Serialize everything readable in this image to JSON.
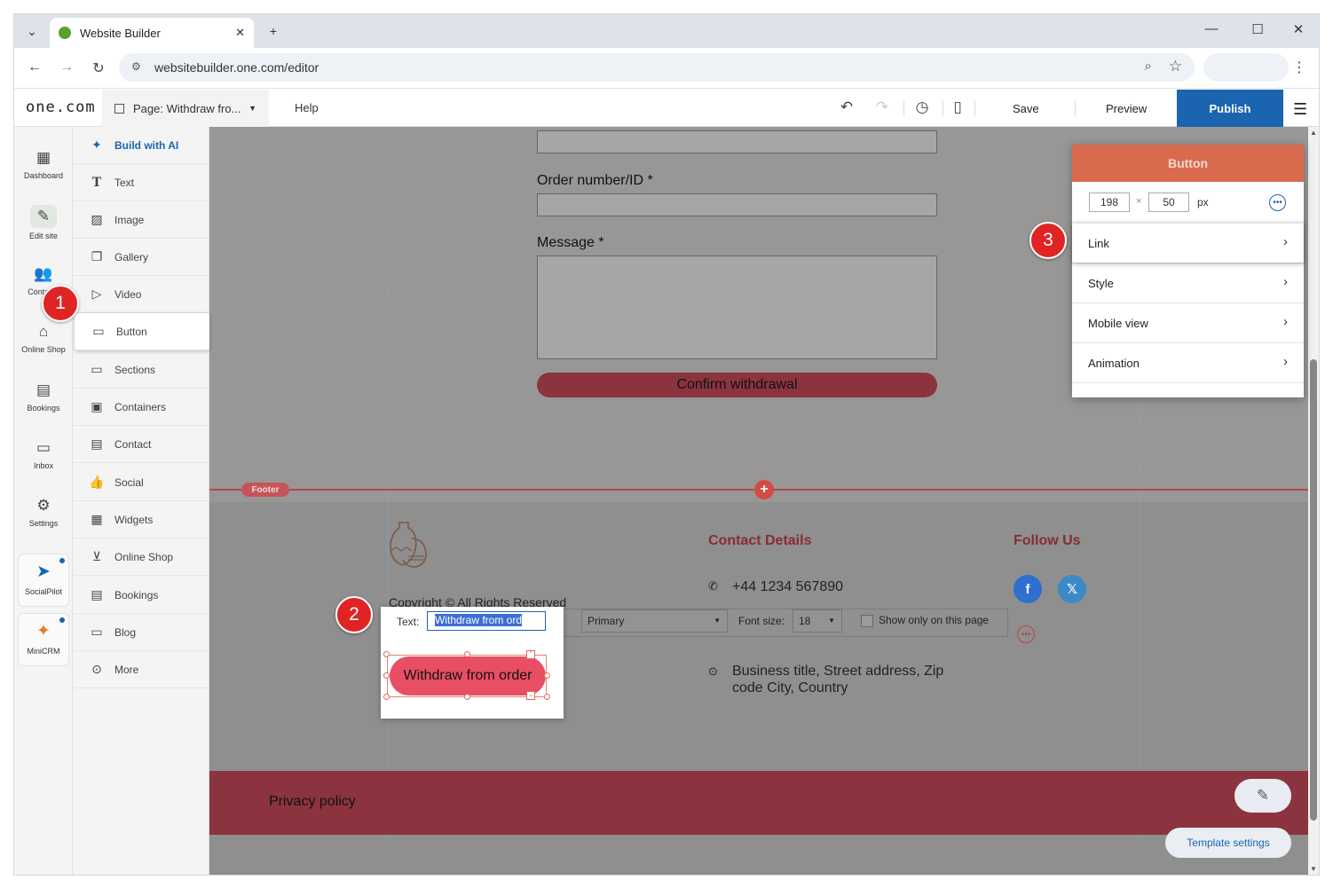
{
  "browser": {
    "tab_title": "Website Builder",
    "url": "websitebuilder.one.com/editor"
  },
  "toolbar": {
    "logo": "one.com",
    "page_label": "Page: Withdraw fro...",
    "help": "Help",
    "save": "Save",
    "preview": "Preview",
    "publish": "Publish"
  },
  "rail": {
    "items": [
      {
        "label": "Dashboard"
      },
      {
        "label": "Edit site"
      },
      {
        "label": "Contacts"
      },
      {
        "label": "Online Shop"
      },
      {
        "label": "Bookings"
      },
      {
        "label": "Inbox"
      },
      {
        "label": "Settings"
      }
    ],
    "apps": [
      {
        "label": "SocialPilot"
      },
      {
        "label": "MiniCRM"
      }
    ]
  },
  "tools": {
    "items": [
      {
        "label": "Build with AI"
      },
      {
        "label": "Text"
      },
      {
        "label": "Image"
      },
      {
        "label": "Gallery"
      },
      {
        "label": "Video"
      },
      {
        "label": "Button"
      },
      {
        "label": "Sections"
      },
      {
        "label": "Containers"
      },
      {
        "label": "Contact"
      },
      {
        "label": "Social"
      },
      {
        "label": "Widgets"
      },
      {
        "label": "Online Shop"
      },
      {
        "label": "Bookings"
      },
      {
        "label": "Blog"
      },
      {
        "label": "More"
      }
    ]
  },
  "form": {
    "order_label": "Order number/ID *",
    "message_label": "Message *",
    "confirm_button": "Confirm withdrawal"
  },
  "footer": {
    "badge": "Footer",
    "copyright": "Copyright © All Rights Reserved",
    "contact_heading": "Contact Details",
    "follow_heading": "Follow Us",
    "phone": "+44 1234 567890",
    "address": "Business title, Street address, Zip code City, Country",
    "privacy": "Privacy policy",
    "template_settings": "Template settings"
  },
  "inline_toolbar": {
    "text_label": "Text:",
    "text_value": "Withdraw from ord",
    "style_value": "Primary",
    "font_size_label": "Font size:",
    "font_size_value": "18",
    "show_only_label": "Show only on this page"
  },
  "selected_button": {
    "text": "Withdraw from order"
  },
  "panel": {
    "title": "Button",
    "width": "198",
    "height": "50",
    "unit": "px",
    "rows": [
      {
        "label": "Link"
      },
      {
        "label": "Style"
      },
      {
        "label": "Mobile view"
      },
      {
        "label": "Animation"
      }
    ]
  },
  "markers": [
    "1",
    "2",
    "3"
  ],
  "colors": {
    "publish": "#1b64b0",
    "brand_red": "#8c3340",
    "button_pink": "#e84f64",
    "marker_red": "#e02424"
  }
}
